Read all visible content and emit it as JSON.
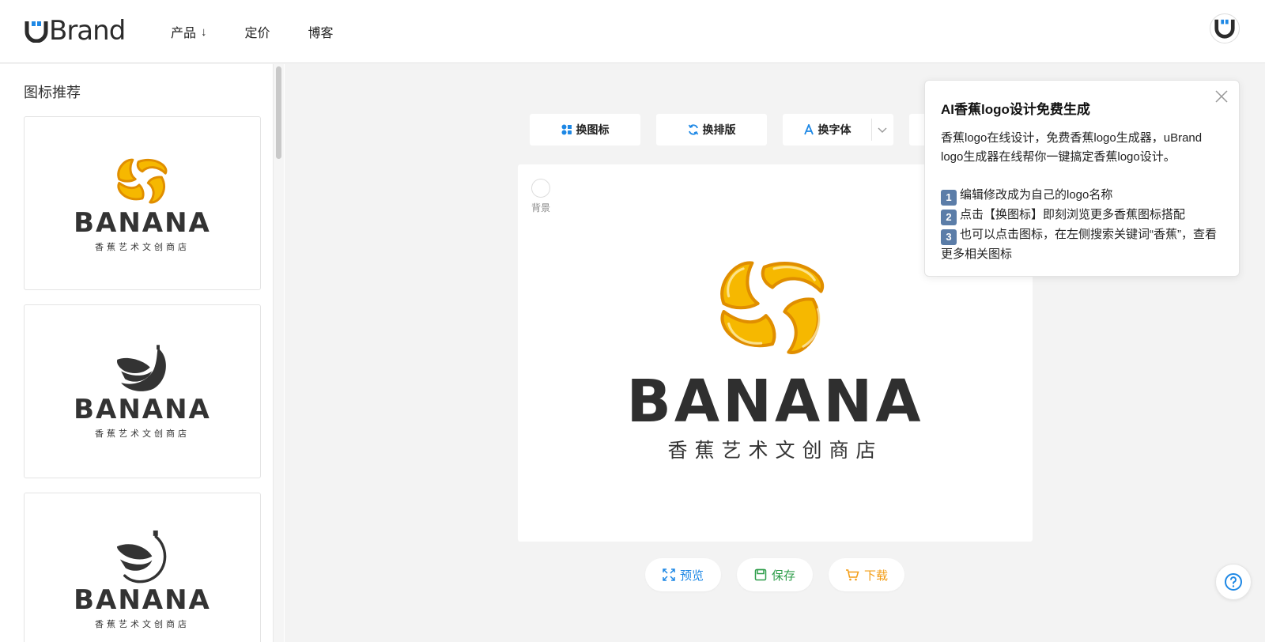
{
  "brand": {
    "logo_text": "Brand",
    "logo_prefix": "u"
  },
  "nav": {
    "items": [
      {
        "label": "产品",
        "arrow": "↓"
      },
      {
        "label": "定价"
      },
      {
        "label": "博客"
      }
    ]
  },
  "sidebar": {
    "title": "图标推荐",
    "cards": [
      {
        "brand": "BANANA",
        "tagline": "香蕉艺术文创商店",
        "icon": "yellow-banana-swirl-icon"
      },
      {
        "brand": "BANANA",
        "tagline": "香蕉艺术文创商店",
        "icon": "black-banana-bunch-icon"
      },
      {
        "brand": "BANANA",
        "tagline": "香蕉艺术文创商店",
        "icon": "black-banana-outline-icon"
      }
    ]
  },
  "toolbar": {
    "change_icon": "换图标",
    "change_layout": "换排版",
    "change_font": "换字体"
  },
  "canvas": {
    "bg_label": "背景",
    "brand": "BANANA",
    "tagline": "香蕉艺术文创商店"
  },
  "actions": {
    "preview": "预览",
    "save": "保存",
    "download": "下载"
  },
  "tip": {
    "title": "AI香蕉logo设计免费生成",
    "intro": "香蕉logo在线设计，免费香蕉logo生成器，uBrand logo生成器在线帮你一键搞定香蕉logo设计。",
    "steps": [
      {
        "num": "1",
        "text": "编辑修改成为自己的logo名称"
      },
      {
        "num": "2",
        "text": "点击【换图标】即刻浏览更多香蕉图标搭配"
      },
      {
        "num": "3",
        "text": "也可以点击图标，在左侧搜索关键词“香蕉”，查看更多相关图标"
      }
    ]
  },
  "colors": {
    "accent_blue": "#1e88e5",
    "save_green": "#2e9d4a",
    "download_orange": "#f39c12",
    "banana_yellow": "#f6b800",
    "banana_edge": "#e08e00",
    "dark": "#333333"
  }
}
